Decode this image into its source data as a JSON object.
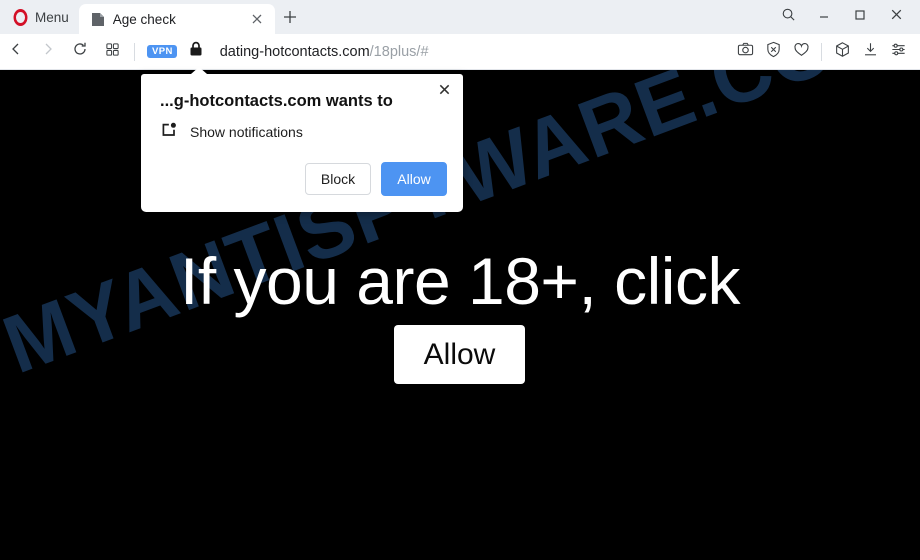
{
  "browser": {
    "menu_label": "Menu",
    "opera_logo_icon": "opera-logo-icon",
    "tabs": [
      {
        "title": "Age check",
        "favicon": "page-favicon-icon",
        "close_icon": "close-icon"
      }
    ],
    "new_tab_icon": "plus-icon",
    "window_controls": {
      "search_icon": "search-icon",
      "minimize_icon": "minimize-icon",
      "maximize_icon": "maximize-icon",
      "close_icon": "close-icon"
    },
    "navigation": {
      "back_icon": "chevron-left-icon",
      "forward_icon": "chevron-right-icon",
      "reload_icon": "reload-icon",
      "tab_overview_icon": "grid-icon"
    },
    "address_bar": {
      "vpn_badge": "VPN",
      "lock_icon": "lock-icon",
      "url_domain": "dating-hotcontacts.com",
      "url_path": "/18plus/#"
    },
    "toolbar_icons": [
      "camera-icon",
      "ad-block-shield-icon",
      "heart-icon",
      "cube-icon",
      "download-icon",
      "easy-setup-sliders-icon"
    ]
  },
  "permission_dialog": {
    "title": "...g-hotcontacts.com wants to",
    "permission_icon": "notification-icon",
    "permission_label": "Show notifications",
    "block_label": "Block",
    "allow_label": "Allow",
    "close_icon": "close-icon",
    "allow_button_color": "#4d94f2"
  },
  "page": {
    "watermark": "MYANTISPYWARE.COM",
    "watermark_color": "#16304f",
    "headline": "If you are 18+, click",
    "allow_button_label": "Allow",
    "background_color": "#000000"
  }
}
